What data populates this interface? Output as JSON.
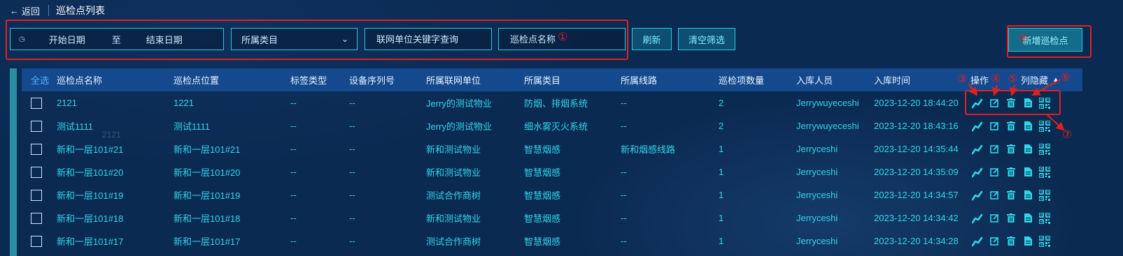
{
  "header": {
    "back_label": "返回",
    "title": "巡检点列表"
  },
  "filters": {
    "start_date": "开始日期",
    "to": "至",
    "end_date": "结束日期",
    "category_placeholder": "所属类目",
    "unit_keyword_placeholder": "联网单位关键字查询",
    "name_placeholder": "巡检点名称"
  },
  "buttons": {
    "refresh": "刷新",
    "clear": "清空筛选",
    "add": "新增巡检点"
  },
  "table": {
    "select_all": "全选",
    "columns": [
      "巡检点名称",
      "巡检点位置",
      "标签类型",
      "设备序列号",
      "所属联网单位",
      "所属类目",
      "所属线路",
      "巡检项数量",
      "入库人员",
      "入库时间",
      "操作",
      "列隐藏"
    ],
    "rows": [
      [
        "2121",
        "1221",
        "--",
        "--",
        "Jerry的测试物业",
        "防烟、排烟系统",
        "--",
        "2",
        "Jerrywuyeceshi",
        "2023-12-20 18:44:20"
      ],
      [
        "测试1111",
        "测试1111",
        "--",
        "--",
        "Jerry的测试物业",
        "细水雾灭火系统",
        "--",
        "2",
        "Jerrywuyeceshi",
        "2023-12-20 18:43:16"
      ],
      [
        "新和一层101#21",
        "新和一层101#21",
        "--",
        "--",
        "新和测试物业",
        "智慧烟感",
        "新和烟感线路",
        "1",
        "Jerryceshi",
        "2023-12-20 14:35:44"
      ],
      [
        "新和一层101#20",
        "新和一层101#20",
        "--",
        "--",
        "新和测试物业",
        "智慧烟感",
        "--",
        "1",
        "Jerryceshi",
        "2023-12-20 14:35:09"
      ],
      [
        "新和一层101#19",
        "新和一层101#19",
        "--",
        "--",
        "测试合作商树",
        "智慧烟感",
        "--",
        "1",
        "Jerryceshi",
        "2023-12-20 14:34:57"
      ],
      [
        "新和一层101#18",
        "新和一层101#18",
        "--",
        "--",
        "新和测试物业",
        "智慧烟感",
        "--",
        "1",
        "Jerryceshi",
        "2023-12-20 14:34:42"
      ],
      [
        "新和一层101#17",
        "新和一层101#17",
        "--",
        "--",
        "测试合作商树",
        "智慧烟感",
        "--",
        "1",
        "Jerryceshi",
        "2023-12-20 14:34:28"
      ]
    ],
    "row_actions": [
      "trend-icon",
      "edit-icon",
      "delete-icon",
      "document-icon",
      "qrcode-icon"
    ]
  },
  "annotations": [
    "①",
    "②",
    "③",
    "④",
    "⑤",
    "⑥",
    "⑦"
  ],
  "watermark": "2121",
  "colors": {
    "accent_cyan": "#2ec7d8",
    "text_cyan": "#30d6e8",
    "header_bg": "#14498d",
    "annotation_red": "#e02020",
    "page_bg": "#0b2a52"
  }
}
